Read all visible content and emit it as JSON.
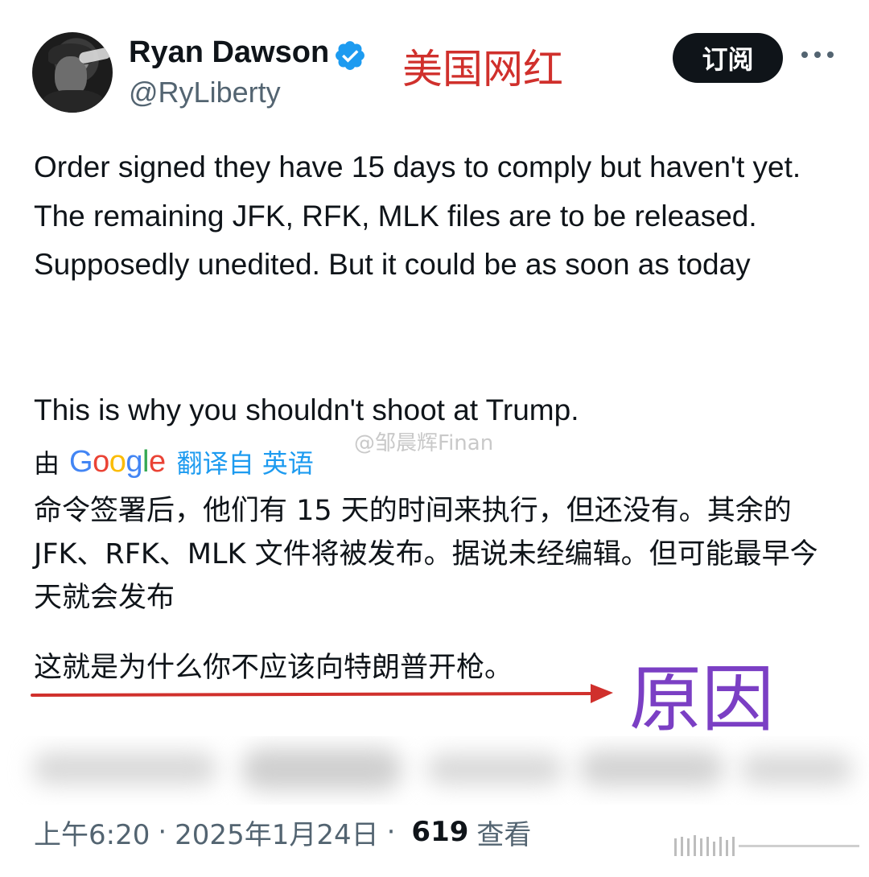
{
  "author": {
    "display_name": "Ryan Dawson",
    "handle": "@RyLiberty"
  },
  "annotations": {
    "top_label": "美国网红",
    "bottom_label": "原因",
    "red_color": "#d0302c",
    "purple_color": "#7b3fc4"
  },
  "header": {
    "subscribe_label": "订阅",
    "more_icon": "more-horizontal-icon"
  },
  "tweet": {
    "text_paragraph_1": "Order signed they have 15 days to comply but haven't yet. The remaining JFK, RFK, MLK files are to be released. Supposedly unedited. But it could be as soon as today",
    "text_paragraph_2": "This is why you shouldn't shoot at Trump."
  },
  "translation": {
    "by_label": "由",
    "google_letters": [
      "G",
      "o",
      "o",
      "g",
      "l",
      "e"
    ],
    "link_label": "翻译自 英语",
    "text_paragraph_1": "命令签署后，他们有 15 天的时间来执行，但还没有。其余的 JFK、RFK、MLK 文件将被发布。据说未经编辑。但可能最早今天就会发布",
    "text_paragraph_2": "这就是为什么你不应该向特朗普开枪。"
  },
  "watermark": "@邹晨辉Finan",
  "footer": {
    "time": "上午6:20",
    "separator": "·",
    "date": "2025年1月24日",
    "views_count": "619",
    "views_label": "查看"
  },
  "colors": {
    "text_primary": "#0f1419",
    "text_secondary": "#536471",
    "accent": "#1d9bf0",
    "button_bg": "#0f1419"
  }
}
